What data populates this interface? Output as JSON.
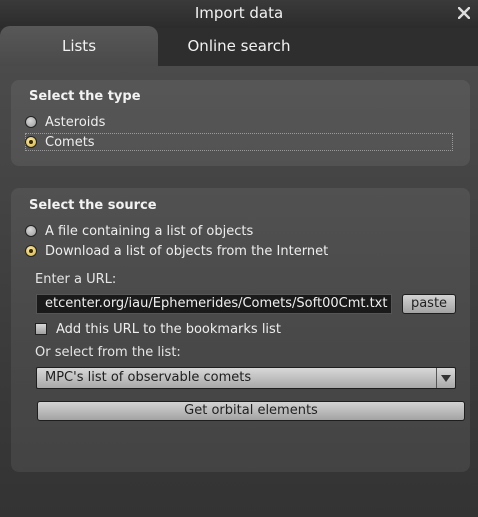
{
  "window": {
    "title": "Import data"
  },
  "tabs": [
    {
      "label": "Lists",
      "active": true
    },
    {
      "label": "Online search",
      "active": false
    }
  ],
  "type_group": {
    "title": "Select the type",
    "options": [
      {
        "label": "Asteroids",
        "checked": false
      },
      {
        "label": "Comets",
        "checked": true
      }
    ]
  },
  "source_group": {
    "title": "Select the source",
    "options": [
      {
        "label": "A file containing a list of objects",
        "checked": false
      },
      {
        "label": "Download a list of objects from the Internet",
        "checked": true
      }
    ],
    "url_label": "Enter a URL:",
    "url_value": "etcenter.org/iau/Ephemerides/Comets/Soft00Cmt.txt",
    "paste_label": "paste",
    "bookmark_label": "Add this URL to the bookmarks list",
    "bookmark_checked": false,
    "list_label": "Or select from the list:",
    "list_selected": "MPC's list of observable comets",
    "get_button_label": "Get orbital elements"
  },
  "icons": {
    "close": "close-icon",
    "dropdown": "chevron-down-icon"
  },
  "colors": {
    "accent_radio": "#d6b43e",
    "background": "#2f2f2f"
  }
}
